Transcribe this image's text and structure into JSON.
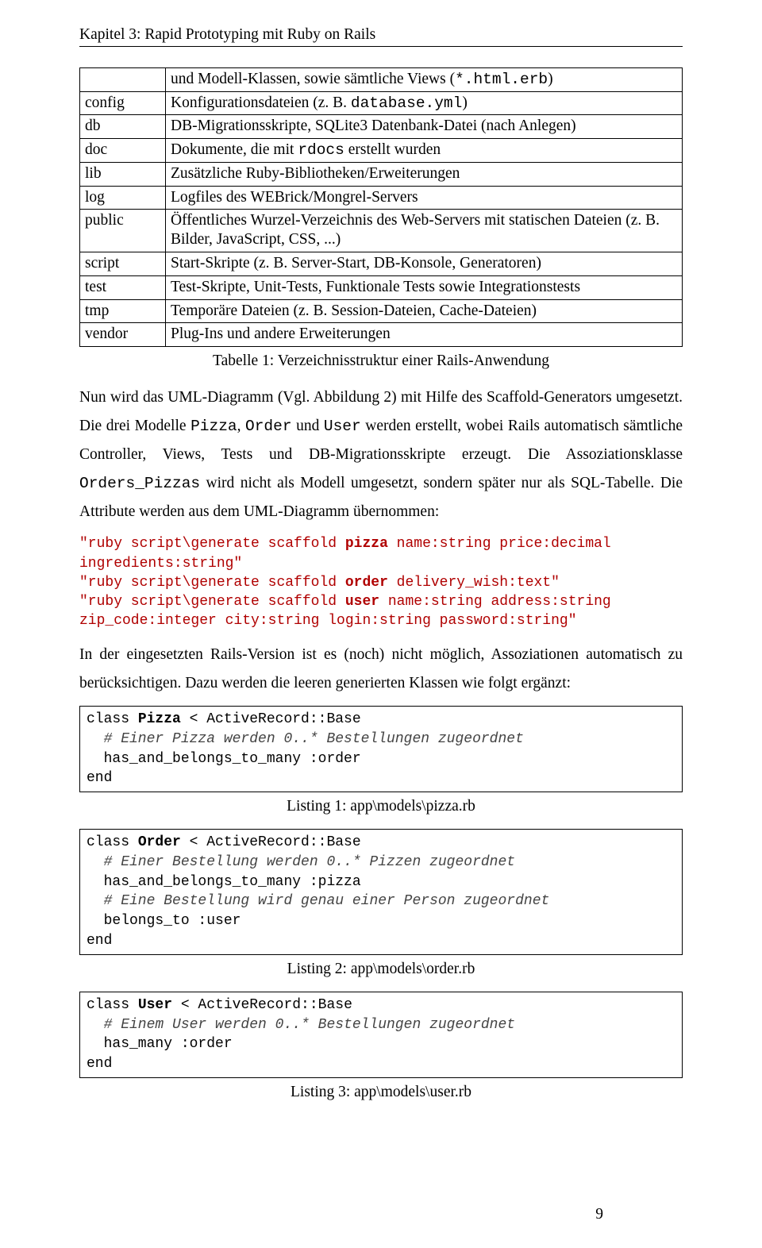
{
  "header": "Kapitel 3: Rapid Prototyping mit Ruby on Rails",
  "dir_table": {
    "rows": [
      {
        "key": "",
        "val_plain_pre": "und Modell-Klassen, sowie sämtliche Views (",
        "val_mono1": "*.html.erb",
        "val_plain_post": ")"
      },
      {
        "key": "config",
        "val_plain_pre": "Konfigurationsdateien (z. B. ",
        "val_mono1": "database.yml",
        "val_plain_post": ")"
      },
      {
        "key": "db",
        "val_plain_pre": "DB-Migrationsskripte, SQLite3 Datenbank-Datei (nach Anlegen)",
        "val_mono1": "",
        "val_plain_post": ""
      },
      {
        "key": "doc",
        "val_plain_pre": "Dokumente, die mit ",
        "val_mono1": "rdocs",
        "val_plain_post": " erstellt wurden"
      },
      {
        "key": "lib",
        "val_plain_pre": "Zusätzliche Ruby-Bibliotheken/Erweiterungen",
        "val_mono1": "",
        "val_plain_post": ""
      },
      {
        "key": "log",
        "val_plain_pre": "Logfiles des WEBrick/Mongrel-Servers",
        "val_mono1": "",
        "val_plain_post": ""
      },
      {
        "key": "public",
        "val_plain_pre": "Öffentliches Wurzel-Verzeichnis des Web-Servers mit statischen Dateien (z. B. Bilder, JavaScript, CSS, ...)",
        "val_mono1": "",
        "val_plain_post": ""
      },
      {
        "key": "script",
        "val_plain_pre": "Start-Skripte (z. B. Server-Start, DB-Konsole, Generatoren)",
        "val_mono1": "",
        "val_plain_post": ""
      },
      {
        "key": "test",
        "val_plain_pre": "Test-Skripte, Unit-Tests, Funktionale Tests sowie Integrationstests",
        "val_mono1": "",
        "val_plain_post": ""
      },
      {
        "key": "tmp",
        "val_plain_pre": "Temporäre Dateien (z. B. Session-Dateien, Cache-Dateien)",
        "val_mono1": "",
        "val_plain_post": ""
      },
      {
        "key": "vendor",
        "val_plain_pre": "Plug-Ins und andere Erweiterungen",
        "val_mono1": "",
        "val_plain_post": ""
      }
    ]
  },
  "table1_caption": "Tabelle 1: Verzeichnisstruktur einer Rails-Anwendung",
  "para1": {
    "t1": "Nun wird das UML-Diagramm (Vgl. Abbildung 2) mit Hilfe des Scaffold-Generators umgesetzt. Die drei Modelle ",
    "m1": "Pizza",
    "t2": ", ",
    "m2": "Order",
    "t3": " und ",
    "m3": "User",
    "t4": " werden erstellt, wobei Rails automatisch sämtliche Controller, Views, Tests und DB-Migrationsskripte erzeugt. Die Assoziationsklasse ",
    "m4": "Orders_Pizzas",
    "t5": " wird nicht als Modell umgesetzt, sondern später nur als SQL-Tabelle. Die Attribute werden aus dem UML-Diagramm übernommen:"
  },
  "code1": {
    "l1a": "\"ruby script\\generate scaffold ",
    "l1b": "pizza",
    "l1c": " name:string price:decimal",
    "l2": "ingredients:string\"",
    "l3a": "\"ruby script\\generate scaffold ",
    "l3b": "order",
    "l3c": " delivery_wish:text\"",
    "l4a": "\"ruby script\\generate scaffold ",
    "l4b": "user",
    "l4c": " name:string address:string",
    "l5": "zip_code:integer city:string login:string password:string\""
  },
  "para2": "In der eingesetzten Rails-Version ist es (noch) nicht möglich, Assoziationen automatisch zu berücksichtigen. Dazu werden die leeren generierten Klassen wie folgt ergänzt:",
  "listing1": {
    "l1a": "class ",
    "l1b": "Pizza",
    "l1c": " < ActiveRecord::Base",
    "l2": "  # Einer Pizza werden 0..* Bestellungen zugeordnet",
    "l3": "  has_and_belongs_to_many :order",
    "l4": "end"
  },
  "listing1_caption": "Listing 1: app\\models\\pizza.rb",
  "listing2": {
    "l1a": "class ",
    "l1b": "Order",
    "l1c": " < ActiveRecord::Base",
    "l2": "  # Einer Bestellung werden 0..* Pizzen zugeordnet",
    "l3": "  has_and_belongs_to_many :pizza",
    "l4": "  # Eine Bestellung wird genau einer Person zugeordnet",
    "l5": "  belongs_to :user",
    "l6": "end"
  },
  "listing2_caption": "Listing 2: app\\models\\order.rb",
  "listing3": {
    "l1a": "class ",
    "l1b": "User",
    "l1c": " < ActiveRecord::Base",
    "l2": "  # Einem User werden 0..* Bestellungen zugeordnet",
    "l3": "  has_many :order",
    "l4": "end"
  },
  "listing3_caption": "Listing 3: app\\models\\user.rb",
  "page_number": "9"
}
